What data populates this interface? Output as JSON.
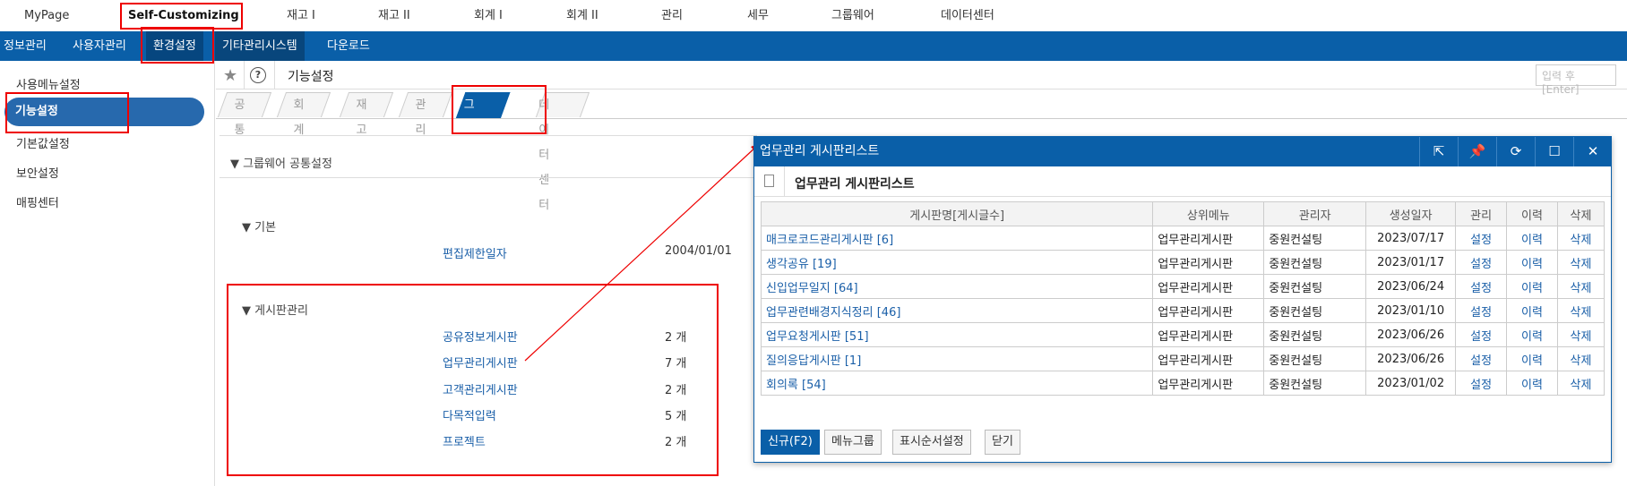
{
  "topnav": {
    "items": [
      "MyPage",
      "Self-Customizing",
      "재고 I",
      "재고 II",
      "회계 I",
      "회계 II",
      "관리",
      "세무",
      "그룹웨어",
      "데이터센터"
    ]
  },
  "bluebar": {
    "items": [
      "정보관리",
      "사용자관리",
      "환경설정",
      "기타관리시스템",
      "다운로드"
    ]
  },
  "sidebar": {
    "items": [
      "사용메뉴설정",
      "기능설정",
      "기본값설정",
      "보안설정",
      "매핑센터"
    ]
  },
  "content": {
    "title": "기능설정",
    "search_placeholder": "입력 후 [Enter]",
    "tabs": [
      "공통",
      "회계",
      "재고",
      "관리",
      "그룹웨어",
      "데이터센터"
    ],
    "section": "그룹웨어 공통설정",
    "basic": {
      "title": "기본",
      "label": "편집제한일자",
      "value": "2004/01/01"
    },
    "board": {
      "title": "게시판관리",
      "rows": [
        {
          "label": "공유정보게시판",
          "value": "2 개"
        },
        {
          "label": "업무관리게시판",
          "value": "7 개"
        },
        {
          "label": "고객관리게시판",
          "value": "2 개"
        },
        {
          "label": "다목적입력",
          "value": "5 개"
        },
        {
          "label": "프로젝트",
          "value": "2 개"
        }
      ]
    }
  },
  "modal": {
    "title": "업무관리 게시판리스트",
    "subtitle": "업무관리 게시판리스트",
    "columns": [
      "게시판명[게시글수]",
      "상위메뉴",
      "관리자",
      "생성일자",
      "관리",
      "이력",
      "삭제"
    ],
    "rows": [
      [
        "매크로코드관리게시판 [6]",
        "업무관리게시판",
        "중원컨설팅",
        "2023/07/17",
        "설정",
        "이력",
        "삭제"
      ],
      [
        "생각공유 [19]",
        "업무관리게시판",
        "중원컨설팅",
        "2023/01/17",
        "설정",
        "이력",
        "삭제"
      ],
      [
        "신입업무일지 [64]",
        "업무관리게시판",
        "중원컨설팅",
        "2023/06/24",
        "설정",
        "이력",
        "삭제"
      ],
      [
        "업무관련배경지식정리 [46]",
        "업무관리게시판",
        "중원컨설팅",
        "2023/01/10",
        "설정",
        "이력",
        "삭제"
      ],
      [
        "업무요청게시판 [51]",
        "업무관리게시판",
        "중원컨설팅",
        "2023/06/26",
        "설정",
        "이력",
        "삭제"
      ],
      [
        "질의응답게시판 [1]",
        "업무관리게시판",
        "중원컨설팅",
        "2023/06/26",
        "설정",
        "이력",
        "삭제"
      ],
      [
        "회의록 [54]",
        "업무관리게시판",
        "중원컨설팅",
        "2023/01/02",
        "설정",
        "이력",
        "삭제"
      ]
    ],
    "buttons": [
      "신규(F2)",
      "메뉴그룹",
      "표시순서설정",
      "닫기"
    ]
  }
}
